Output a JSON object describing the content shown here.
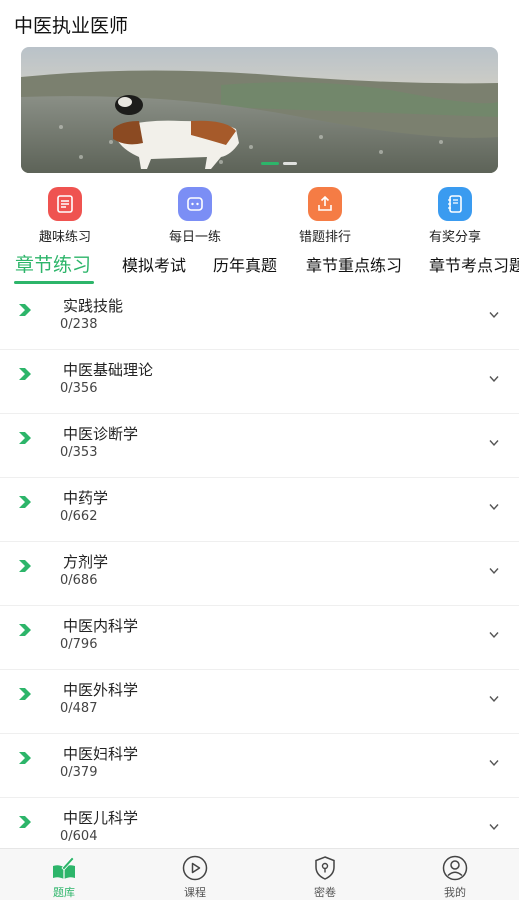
{
  "app": {
    "title": "中医执业医师"
  },
  "banner": {
    "slides": 2,
    "active_slide": 1
  },
  "quick_actions": [
    {
      "label": "趣味练习",
      "icon": "checklist-icon",
      "color": "#ef5350"
    },
    {
      "label": "每日一练",
      "icon": "robot-icon",
      "color": "#7b8ef5"
    },
    {
      "label": "错题排行",
      "icon": "upload-tray-icon",
      "color": "#f57c45"
    },
    {
      "label": "有奖分享",
      "icon": "notebook-icon",
      "color": "#3a9bf0"
    }
  ],
  "tabs": [
    {
      "label": "章节练习",
      "active": true
    },
    {
      "label": "模拟考试",
      "active": false
    },
    {
      "label": "历年真题",
      "active": false
    },
    {
      "label": "章节重点练习",
      "active": false
    },
    {
      "label": "章节考点习题",
      "active": false
    }
  ],
  "chapters": [
    {
      "title": "实践技能",
      "count": "0/238"
    },
    {
      "title": "中医基础理论",
      "count": "0/356"
    },
    {
      "title": "中医诊断学",
      "count": "0/353"
    },
    {
      "title": "中药学",
      "count": "0/662"
    },
    {
      "title": "方剂学",
      "count": "0/686"
    },
    {
      "title": "中医内科学",
      "count": "0/796"
    },
    {
      "title": "中医外科学",
      "count": "0/487"
    },
    {
      "title": "中医妇科学",
      "count": "0/379"
    },
    {
      "title": "中医儿科学",
      "count": "0/604"
    }
  ],
  "bottom_nav": [
    {
      "label": "题库",
      "icon": "question-bank-icon",
      "active": true
    },
    {
      "label": "课程",
      "icon": "play-circle-icon",
      "active": false
    },
    {
      "label": "密卷",
      "icon": "shield-lock-icon",
      "active": false
    },
    {
      "label": "我的",
      "icon": "user-circle-icon",
      "active": false
    }
  ],
  "colors": {
    "accent": "#2db56a",
    "text": "#222222",
    "divider": "#efefef"
  }
}
